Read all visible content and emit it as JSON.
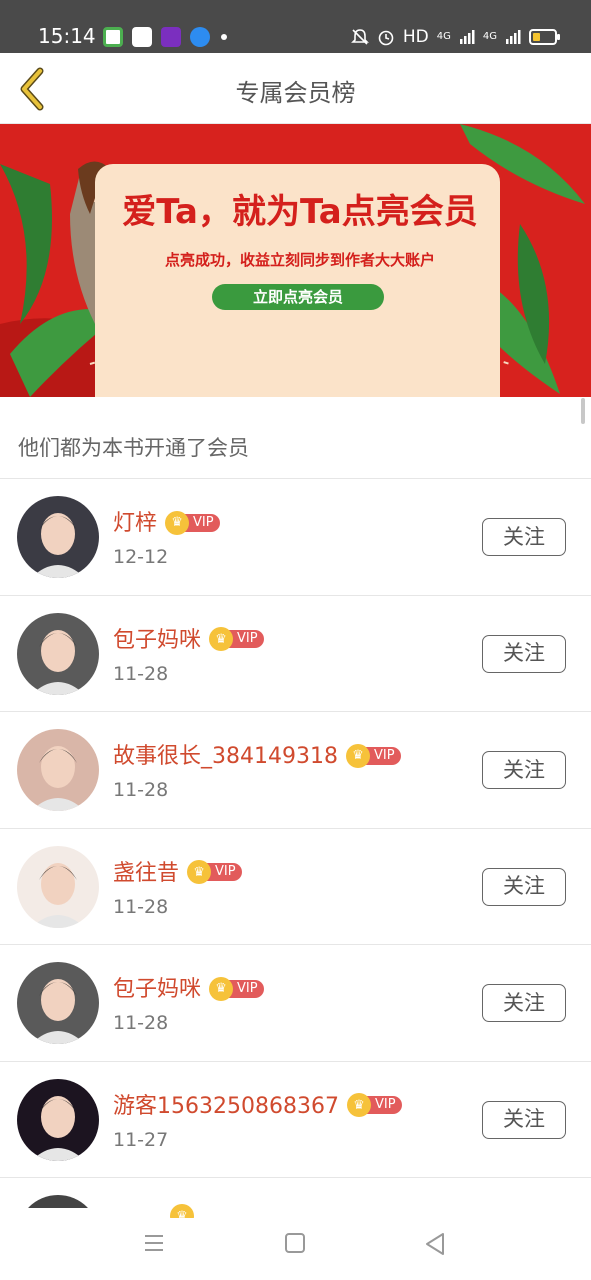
{
  "status_bar": {
    "time": "15:14",
    "network": "HD",
    "signal1": "4G",
    "signal2": "4G",
    "icons": [
      "app-icon-1",
      "app-icon-2",
      "app-icon-3",
      "app-icon-4",
      "notification-dot",
      "mute-icon",
      "alarm-icon",
      "battery-icon"
    ]
  },
  "header": {
    "title": "专属会员榜",
    "back_icon": "chevron-left-icon"
  },
  "banner": {
    "title": "爱Ta，就为Ta点亮会员",
    "subtitle": "点亮成功，收益立刻同步到作者大大账户",
    "button_label": "立即点亮会员"
  },
  "section": {
    "label": "他们都为本书开通了会员"
  },
  "vip_label": "VIP",
  "follow_label": "关注",
  "members": [
    {
      "name": "灯梓",
      "date": "12-12",
      "avatar_color": "#3b3b44"
    },
    {
      "name": "包子妈咪",
      "date": "11-28",
      "avatar_color": "#5a5a5a"
    },
    {
      "name": "故事很长_384149318",
      "date": "11-28",
      "avatar_color": "#d9b6a8"
    },
    {
      "name": "盏往昔",
      "date": "11-28",
      "avatar_color": "#f3ebe6"
    },
    {
      "name": "包子妈咪",
      "date": "11-28",
      "avatar_color": "#5a5a5a"
    },
    {
      "name": "游客1563250868367",
      "date": "11-27",
      "avatar_color": "#1c1420"
    }
  ],
  "colors": {
    "accent": "#d04a2e",
    "banner_red": "#d7221e",
    "vip_red": "#e25b5b",
    "crown_gold": "#f6c23a",
    "back_arrow": "#c9a227"
  }
}
